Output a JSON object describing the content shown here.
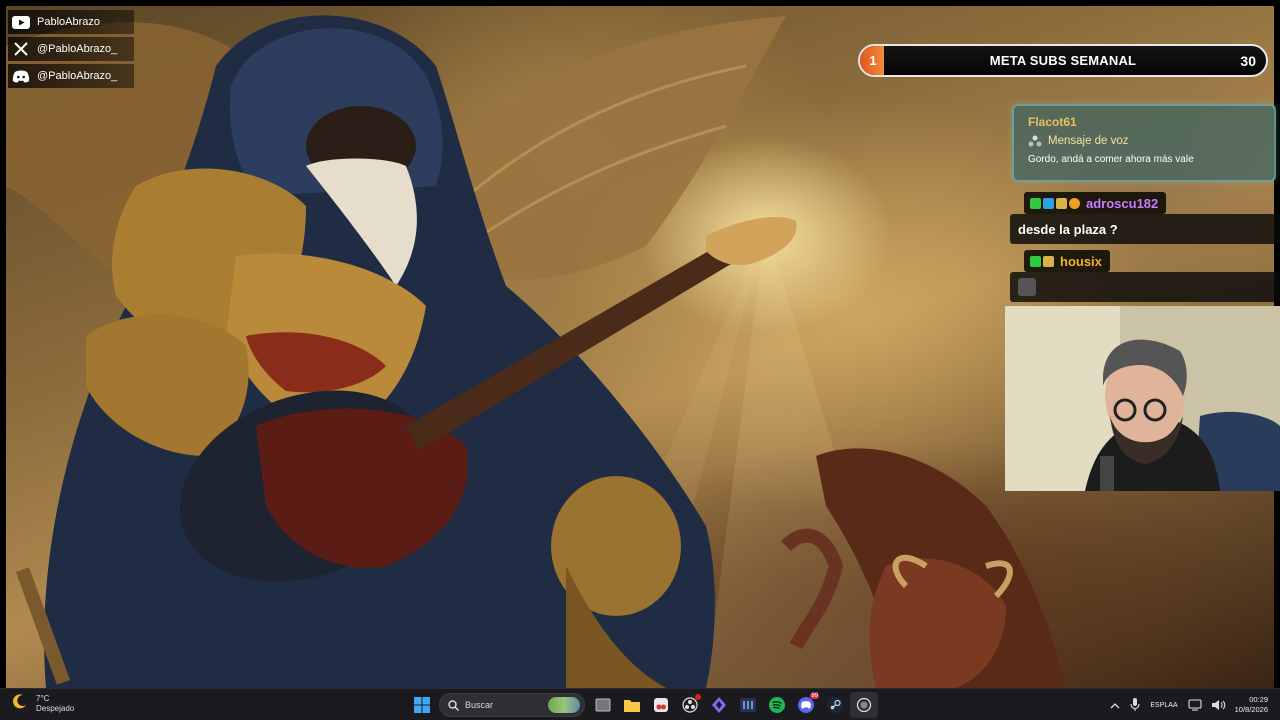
{
  "socials": [
    {
      "icon": "youtube-icon",
      "label": "PabloAbrazo"
    },
    {
      "icon": "x-icon",
      "label": "@PabloAbrazo_"
    },
    {
      "icon": "discord-icon",
      "label": "@PabloAbrazo_"
    }
  ],
  "meta": {
    "title": "META SUBS SEMANAL",
    "current": "1",
    "goal": "30",
    "progress_fraction": 0.033
  },
  "voice_card": {
    "user": "Flacot61",
    "type_label": "Mensaje de voz",
    "message": "Gordo, andá a comer ahora más vale"
  },
  "chat": [
    {
      "user": "adroscu182",
      "user_color": "#c77dff",
      "badges": [
        "#2ecc40",
        "#29a3e6",
        "#d9b24c",
        "#f0a020"
      ],
      "text": "desde la plaza ?"
    },
    {
      "user": "housix",
      "user_color": "#f0b429",
      "badges": [
        "#2ecc40",
        "#d9b24c"
      ],
      "text": ""
    }
  ],
  "taskbar": {
    "weather_temp": "7°C",
    "weather_desc": "Despejado",
    "search_placeholder": "Buscar",
    "lang_top": "ESP",
    "lang_bottom": "LAA",
    "time": "00:29",
    "date": "10/8/2026",
    "discord_badge": "99"
  }
}
